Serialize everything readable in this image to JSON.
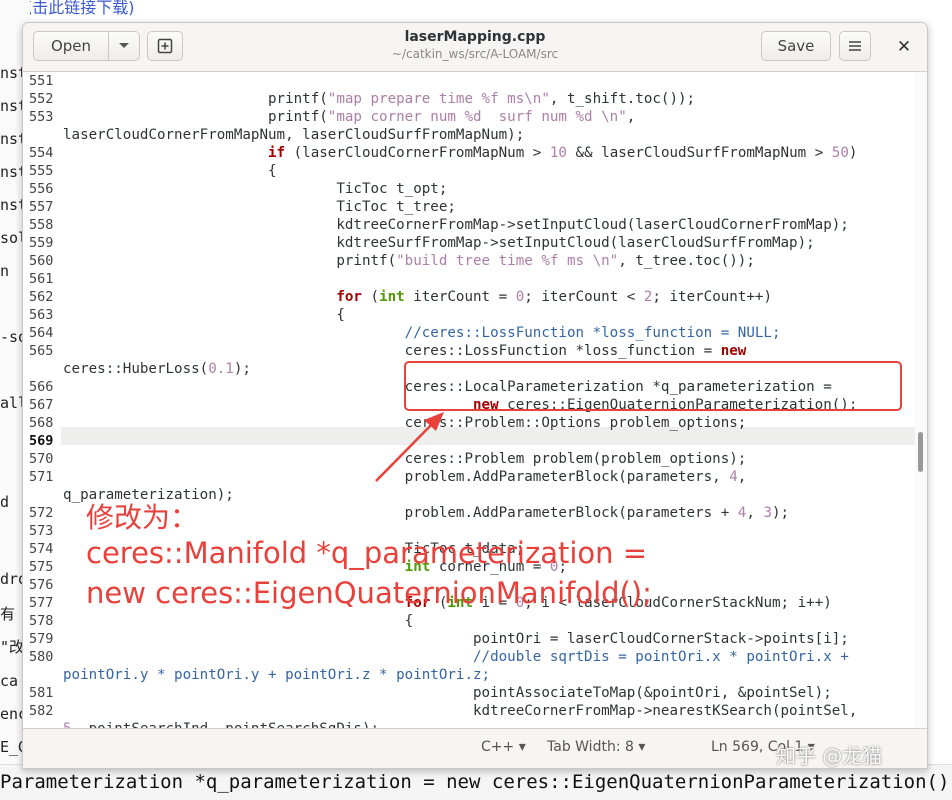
{
  "background": {
    "top_text": "(点击此链接下载)",
    "left_fragments": [
      "nst",
      "nst",
      "nst",
      "nst",
      "nst",
      "sol",
      "n",
      "-so",
      "all",
      "d",
      "dro",
      "有",
      "\"改",
      "ca",
      "enc",
      "E_G"
    ],
    "bottom_text": "Parameterization *q_parameterization = new ceres::EigenQuaternionParameterization()"
  },
  "window": {
    "title": "laserMapping.cpp",
    "subtitle": "~/catkin_ws/src/A-LOAM/src",
    "open_label": "Open",
    "open_dropdown_icon": "chevron-down-icon",
    "new_tab_icon": "new-tab-icon",
    "save_label": "Save",
    "menu_icon": "hamburger-icon",
    "close_icon": "close-icon"
  },
  "editor": {
    "line_numbers": [
      "551",
      "552",
      "553",
      "",
      "554",
      "555",
      "556",
      "557",
      "558",
      "559",
      "560",
      "561",
      "562",
      "563",
      "564",
      "565",
      "",
      "566",
      "567",
      "568",
      "569",
      "570",
      "571",
      "",
      "572",
      "573",
      "574",
      "575",
      "576",
      "577",
      "578",
      "579",
      "580",
      "",
      "581",
      "582",
      ""
    ],
    "current_line": "569"
  },
  "statusbar": {
    "language": "C++",
    "tab_width": "Tab Width: 8",
    "position": "Ln 569, Col 1"
  },
  "annotation": {
    "line1": "修改为：",
    "line2": "ceres::Manifold *q_parameterization =",
    "line3": "new ceres::EigenQuaternionManifold();",
    "color": "#e8403a"
  },
  "watermark": "知乎 @龙猫"
}
